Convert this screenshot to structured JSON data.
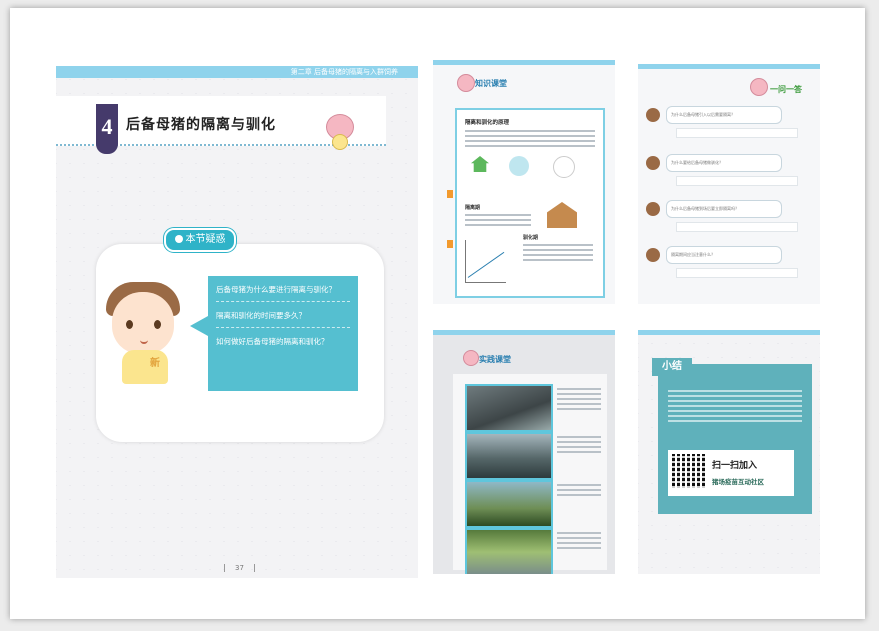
{
  "main_page": {
    "header_text": "第二章 后备母猪的隔离与入群饲养",
    "chapter_number": "4",
    "chapter_title": "后备母猪的隔离与驯化",
    "section_tag": "本节疑惑",
    "questions": [
      "后备母猪为什么要进行隔离与驯化？",
      "隔离和驯化的时间要多久？",
      "如何做好后备母猪的隔离和驯化？"
    ],
    "boy_shirt_char": "新",
    "page_number": "37"
  },
  "page_top_right_1": {
    "title": "知识课堂",
    "heading": "隔离和驯化的原理",
    "label_a": "隔离期",
    "label_b": "驯化期"
  },
  "page_top_right_2": {
    "title": "一问一答",
    "questions": [
      "为什么后备母猪引入以后需要隔离？",
      "为什么要给后备母猪做驯化？",
      "为什么后备母猪到场后要立即隔离吗？",
      "隔离期间应当注意什么？"
    ]
  },
  "page_bottom_left": {
    "title": "实践课堂"
  },
  "page_bottom_right": {
    "title": "小结",
    "scan_text": "扫一扫加入",
    "community_text": "猪场疫苗互动社区"
  },
  "colors": {
    "accent": "#55bfd0",
    "topbar": "#8fd3ec",
    "chapter_tab": "#453a6b",
    "summary": "#5fb1bb"
  }
}
